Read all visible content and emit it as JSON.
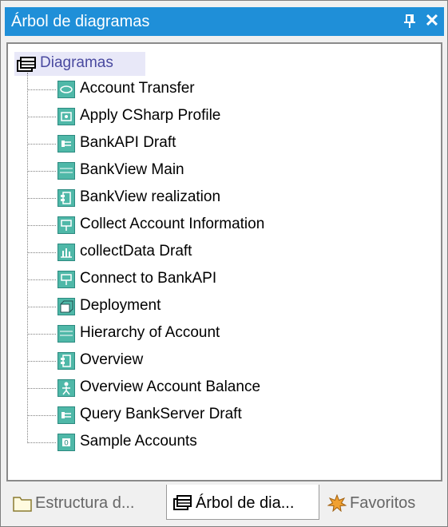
{
  "window": {
    "title": "Árbol de diagramas",
    "pin_icon": "pin-icon",
    "close_icon": "close-icon",
    "close_glyph": "✕"
  },
  "tree": {
    "root": {
      "label": "Diagramas",
      "icon": "diagram-folder-icon"
    },
    "items": [
      {
        "label": "Account Transfer",
        "icon": "use-case-diagram-icon"
      },
      {
        "label": "Apply CSharp Profile",
        "icon": "profile-diagram-icon"
      },
      {
        "label": "BankAPI Draft",
        "icon": "sequence-diagram-icon"
      },
      {
        "label": "BankView Main",
        "icon": "class-diagram-icon"
      },
      {
        "label": "BankView realization",
        "icon": "component-diagram-icon"
      },
      {
        "label": "Collect Account Information",
        "icon": "package-diagram-icon"
      },
      {
        "label": "collectData Draft",
        "icon": "timing-diagram-icon"
      },
      {
        "label": "Connect to BankAPI",
        "icon": "package-diagram-icon"
      },
      {
        "label": "Deployment",
        "icon": "deployment-diagram-icon"
      },
      {
        "label": "Hierarchy of Account",
        "icon": "class-diagram-icon"
      },
      {
        "label": "Overview",
        "icon": "component-diagram-icon"
      },
      {
        "label": "Overview Account Balance",
        "icon": "composite-structure-diagram-icon"
      },
      {
        "label": "Query BankServer Draft",
        "icon": "sequence-diagram-icon"
      },
      {
        "label": "Sample Accounts",
        "icon": "object-diagram-icon"
      }
    ]
  },
  "tabs": [
    {
      "label": "Estructura d...",
      "icon": "folder-icon",
      "active": false
    },
    {
      "label": "Árbol de dia...",
      "icon": "diagram-tree-icon",
      "active": true
    },
    {
      "label": "Favoritos",
      "icon": "favorites-icon",
      "active": false
    }
  ],
  "colors": {
    "title_bar": "#1f8fd8",
    "diagram_icon": "#4fb8a8",
    "root_highlight": "#e8e8f8"
  }
}
